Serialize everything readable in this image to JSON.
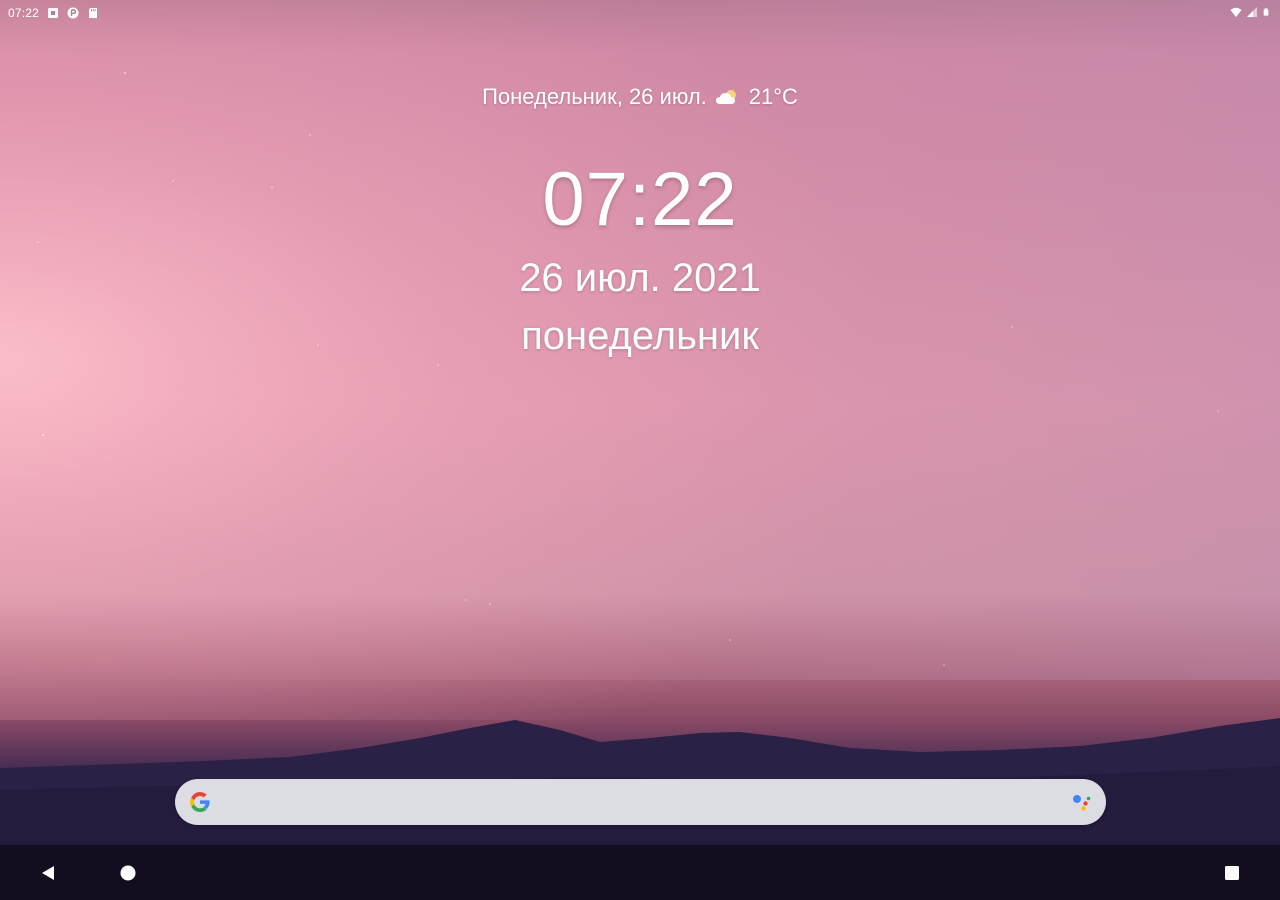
{
  "status_bar": {
    "time": "07:22",
    "left_icons": [
      "notification-square-icon",
      "app-p-icon",
      "sd-card-icon"
    ],
    "right_icons": [
      "wifi-icon",
      "signal-icon",
      "battery-icon"
    ]
  },
  "clock_widget": {
    "glance_text": "Понедельник, 26 июл.",
    "weather_icon": "partly-cloudy-icon",
    "temperature": "21°C",
    "time": "07:22",
    "date": "26 июл. 2021",
    "weekday": "понедельник"
  },
  "search_bar": {
    "logo_icon": "google-g-icon",
    "assistant_icon": "google-assistant-icon"
  },
  "nav_bar": {
    "back_icon": "back-triangle-icon",
    "home_icon": "home-circle-icon",
    "recents_icon": "recents-square-icon"
  },
  "colors": {
    "sky_top": "#d78aa5",
    "sky_glow": "#f8b8c4",
    "mountains": "#2a1f45",
    "search_bar": "#dcdce3",
    "nav_bar": "#130d1f",
    "google_blue": "#4285F4",
    "google_red": "#EA4335",
    "google_yellow": "#FBBC05",
    "google_green": "#34A853"
  }
}
